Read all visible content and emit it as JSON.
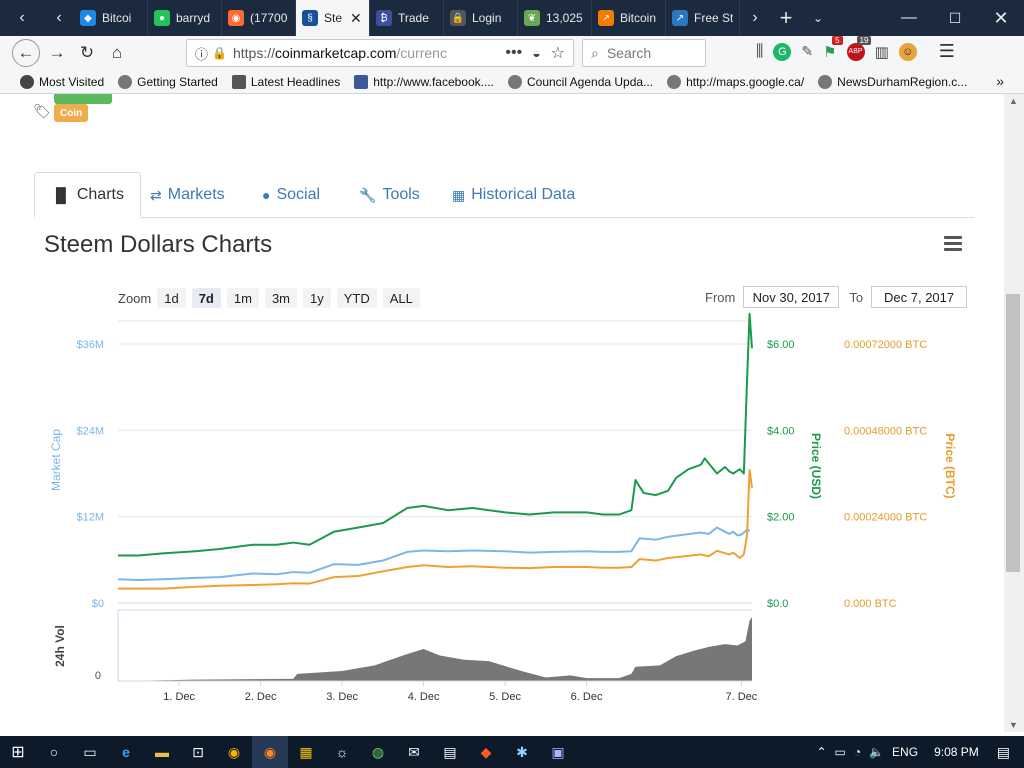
{
  "browser": {
    "tabs": [
      {
        "label": "Bitcoi",
        "color": "#1e88e5",
        "icon": "bitcoin-tab-icon",
        "glyph": "◆"
      },
      {
        "label": "barryd",
        "color": "#22c35a",
        "icon": "green-dot-tab-icon",
        "glyph": "●"
      },
      {
        "label": "(17700",
        "color": "#ff6a33",
        "icon": "orange-tab-icon",
        "glyph": "◉"
      },
      {
        "label": "Ste",
        "color": "#1a5099",
        "icon": "steem-tab-icon",
        "glyph": "§"
      },
      {
        "label": "Trade",
        "color": "#3b4ea0",
        "icon": "trade-tab-icon",
        "glyph": "₿"
      },
      {
        "label": "Login",
        "color": "#555555",
        "icon": "lock-tab-icon",
        "glyph": "🔒"
      },
      {
        "label": "13,025",
        "color": "#6aa84f",
        "icon": "leaf-tab-icon",
        "glyph": "❦"
      },
      {
        "label": "Bitcoin",
        "color": "#f57c00",
        "icon": "chart-tab-icon",
        "glyph": "↗"
      },
      {
        "label": "Free St",
        "color": "#2a78c2",
        "icon": "free-tab-icon",
        "glyph": "↗"
      }
    ],
    "url_prefix": "https://",
    "url_domain": "coinmarketcap.com",
    "url_rest": "/currenc",
    "search_placeholder": "Search",
    "ext_badge_1": "5",
    "ext_badge_2": "19",
    "bookmarks": [
      {
        "label": "Most Visited",
        "icon": "gear-icon"
      },
      {
        "label": "Getting Started",
        "icon": "firefox-icon"
      },
      {
        "label": "Latest Headlines",
        "icon": "rss-icon"
      },
      {
        "label": "http://www.facebook....",
        "icon": "facebook-icon"
      },
      {
        "label": "Council Agenda Upda...",
        "icon": "globe-icon"
      },
      {
        "label": "http://maps.google.ca/",
        "icon": "globe-icon"
      },
      {
        "label": "NewsDurhamRegion.c...",
        "icon": "globe-icon"
      }
    ]
  },
  "page": {
    "tag_coin": "Coin",
    "tabs": [
      {
        "label": "Charts",
        "icon": "bar-chart-icon",
        "glyph": "▐▌"
      },
      {
        "label": "Markets",
        "icon": "exchange-icon",
        "glyph": "⇄"
      },
      {
        "label": "Social",
        "icon": "globe-icon",
        "glyph": "●"
      },
      {
        "label": "Tools",
        "icon": "wrench-icon",
        "glyph": "🔧"
      },
      {
        "label": "Historical Data",
        "icon": "calendar-icon",
        "glyph": "▦"
      }
    ],
    "chart_title": "Steem Dollars Charts",
    "zoom_label": "Zoom",
    "zoom_buttons": [
      "1d",
      "7d",
      "1m",
      "3m",
      "1y",
      "YTD",
      "ALL"
    ],
    "zoom_selected": 1,
    "from_label": "From",
    "from_value": "Nov 30, 2017",
    "to_label": "To",
    "to_value": "Dec 7, 2017"
  },
  "chart_data": {
    "type": "line",
    "x_ticks": [
      "1. Dec",
      "2. Dec",
      "3. Dec",
      "4. Dec",
      "5. Dec",
      "6. Dec",
      "7. Dec"
    ],
    "y_left_label": "Market Cap",
    "y_left_ticks": [
      "$0",
      "$12M",
      "$24M",
      "$36M"
    ],
    "y_left_range": [
      0,
      36
    ],
    "y_price_label": "Price (USD)",
    "y_price_ticks": [
      "$0.0",
      "$2.00",
      "$4.00",
      "$6.00"
    ],
    "y_price_range": [
      0,
      6
    ],
    "y_btc_label": "Price (BTC)",
    "y_btc_ticks": [
      "0.000 BTC",
      "0.00024000 BTC",
      "0.00048000 BTC",
      "0.00072000 BTC"
    ],
    "volume_label": "24h Vol",
    "volume_ticks": [
      "0"
    ],
    "x_days": [
      -0.75,
      0,
      1,
      2,
      3,
      4,
      5,
      5.5,
      6,
      6.9
    ],
    "series": [
      {
        "name": "Market Cap",
        "color": "#7cb5ec",
        "x": [
          -0.75,
          -0.5,
          -0.2,
          0.2,
          0.5,
          0.9,
          1.2,
          1.4,
          1.6,
          1.9,
          2.2,
          2.5,
          2.8,
          3.0,
          3.3,
          3.6,
          4.0,
          4.3,
          4.6,
          5.0,
          5.2,
          5.4,
          5.55,
          5.65,
          5.85,
          6.0,
          6.2,
          6.4,
          6.5,
          6.6,
          6.75,
          6.8,
          6.85,
          6.9,
          6.97,
          7.0
        ],
        "y": [
          3.3,
          3.2,
          3.3,
          3.5,
          3.6,
          4.1,
          4.0,
          4.3,
          4.2,
          5.4,
          5.3,
          5.9,
          7.1,
          7.3,
          7.2,
          7.3,
          7.2,
          7.0,
          7.1,
          7.2,
          7.1,
          7.1,
          7.2,
          9.0,
          8.8,
          9.2,
          9.5,
          9.8,
          9.6,
          10.5,
          9.6,
          9.9,
          9.4,
          9.5,
          10.2,
          10.0
        ]
      },
      {
        "name": "Price (USD)",
        "color": "#1a9a4a",
        "x": [
          -0.75,
          -0.5,
          -0.2,
          0.2,
          0.5,
          0.9,
          1.2,
          1.4,
          1.6,
          1.9,
          2.2,
          2.5,
          2.8,
          3.0,
          3.3,
          3.6,
          4.0,
          4.3,
          4.6,
          5.0,
          5.2,
          5.4,
          5.55,
          5.6,
          5.7,
          5.85,
          6.0,
          6.1,
          6.25,
          6.4,
          6.45,
          6.6,
          6.7,
          6.75,
          6.8,
          6.88,
          6.93,
          6.97,
          7.0,
          7.03
        ],
        "y": [
          1.1,
          1.1,
          1.15,
          1.2,
          1.25,
          1.35,
          1.35,
          1.4,
          1.35,
          1.65,
          1.75,
          1.85,
          2.2,
          2.25,
          2.15,
          2.2,
          2.1,
          2.05,
          2.1,
          2.1,
          2.05,
          2.05,
          2.15,
          2.85,
          2.55,
          2.5,
          2.6,
          2.9,
          3.1,
          3.2,
          3.35,
          3.0,
          3.15,
          3.05,
          3.0,
          3.1,
          3.0,
          5.2,
          6.7,
          5.9
        ]
      },
      {
        "name": "Price (BTC)",
        "color": "#f0a030",
        "x": [
          -0.75,
          -0.5,
          -0.2,
          0.2,
          0.5,
          0.9,
          1.2,
          1.4,
          1.6,
          1.9,
          2.2,
          2.5,
          2.8,
          3.0,
          3.3,
          3.6,
          4.0,
          4.3,
          4.6,
          5.0,
          5.2,
          5.4,
          5.55,
          5.65,
          5.85,
          6.0,
          6.2,
          6.4,
          6.5,
          6.6,
          6.75,
          6.8,
          6.88,
          6.93,
          6.97,
          7.0,
          7.03
        ],
        "y": [
          4e-05,
          4e-05,
          4e-05,
          4.5e-05,
          4.8e-05,
          5e-05,
          5.2e-05,
          5.5e-05,
          5.4e-05,
          7.2e-05,
          7.5e-05,
          8.8e-05,
          0.0001,
          0.000105,
          0.0001,
          0.000102,
          9.8e-05,
          9.7e-05,
          0.0001,
          0.0001,
          9.8e-05,
          9.8e-05,
          0.0001,
          0.000122,
          0.000118,
          0.000125,
          0.00013,
          0.000135,
          0.00013,
          0.000145,
          0.000135,
          0.00014,
          0.000125,
          0.000135,
          0.00019,
          0.00037,
          0.00032
        ]
      }
    ],
    "volume": {
      "color": "#777777",
      "x": [
        -0.75,
        0.2,
        1.4,
        1.45,
        2.0,
        2.4,
        2.8,
        3.0,
        3.2,
        3.5,
        3.8,
        4.2,
        4.5,
        4.8,
        5.0,
        5.4,
        5.55,
        5.6,
        5.9,
        6.1,
        6.3,
        6.5,
        6.7,
        6.85,
        6.95,
        7.0,
        7.03
      ],
      "y": [
        0.0,
        0.02,
        0.03,
        0.1,
        0.14,
        0.22,
        0.38,
        0.45,
        0.36,
        0.3,
        0.28,
        0.14,
        0.05,
        0.08,
        0.04,
        0.04,
        0.1,
        0.2,
        0.22,
        0.35,
        0.42,
        0.48,
        0.52,
        0.5,
        0.56,
        0.85,
        0.9
      ]
    }
  },
  "taskbar": {
    "lang": "ENG",
    "time": "9:08 PM"
  }
}
